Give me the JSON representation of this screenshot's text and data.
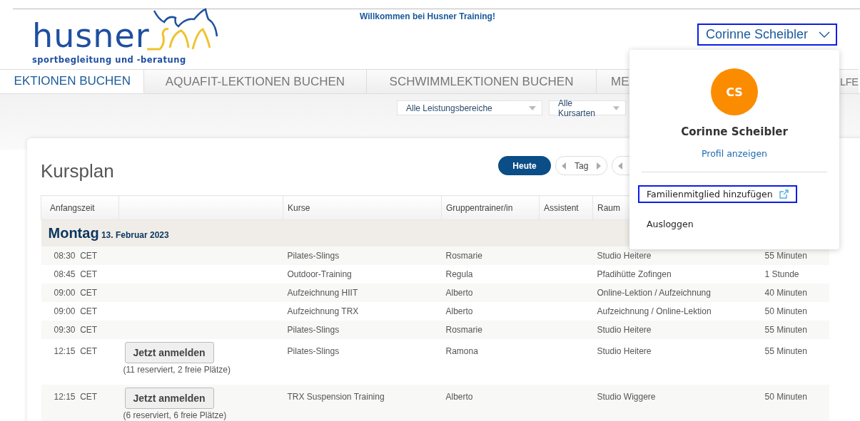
{
  "header": {
    "logo": {
      "wordmark": "husner",
      "tagline": "sportbegleitung und -beratung"
    },
    "welcome": "Willkommen bei Husner Training!",
    "user_button": {
      "label": "Corinne Scheibler",
      "outlined": true,
      "expanded": true
    }
  },
  "tabs": [
    {
      "label": "EKTIONEN BUCHEN",
      "selected": true
    },
    {
      "label": "AQUAFIT-LEKTIONEN BUCHEN",
      "selected": false
    },
    {
      "label": "SCHWIMMLEKTIONEN BUCHEN",
      "selected": false
    },
    {
      "label": "ME",
      "selected": false
    },
    {
      "label": "LFE",
      "selected": false
    }
  ],
  "filters": [
    {
      "label": "Alle Leistungsbereiche"
    },
    {
      "label": "Alle Kursarten"
    }
  ],
  "schedule": {
    "title": "Kursplan",
    "today_button": "Heute",
    "range_button": "Tag",
    "columns": [
      "Anfangszeit",
      "",
      "Kurse",
      "Gruppentrainer/in",
      "Assistent",
      "Raum",
      ""
    ],
    "day": {
      "weekday": "Montag",
      "date": "13. Februar 2023"
    },
    "rows": [
      {
        "kind": "plain",
        "time": "08:30",
        "zone": "CET",
        "course": "Pilates-Slings",
        "trainer": "Rosmarie",
        "room": "Studio Heitere",
        "duration": "55 Minuten"
      },
      {
        "kind": "plain",
        "time": "08:45",
        "zone": "CET",
        "course": "Outdoor-Training",
        "trainer": "Regula",
        "room": "Pfadihütte Zofingen",
        "duration": "1 Stunde"
      },
      {
        "kind": "plain",
        "time": "09:00",
        "zone": "CET",
        "course": "Aufzeichnung HIIT",
        "trainer": "Alberto",
        "room": "Online-Lektion / Aufzeichnung",
        "duration": "40 Minuten"
      },
      {
        "kind": "plain",
        "time": "09:00",
        "zone": "CET",
        "course": "Aufzeichnung TRX",
        "trainer": "Alberto",
        "room": "Aufzeichnung / Online-Lektion",
        "duration": "50 Minuten"
      },
      {
        "kind": "plain",
        "time": "09:30",
        "zone": "CET",
        "course": "Pilates-Slings",
        "trainer": "Rosmarie",
        "room": "Studio Heitere",
        "duration": "55 Minuten"
      },
      {
        "kind": "bookable",
        "time": "12:15",
        "zone": "CET",
        "button": "Jetzt anmelden",
        "note": "(11 reserviert, 2 freie Plätze)",
        "course": "Pilates-Slings",
        "trainer": "Ramona",
        "room": "Studio Heitere",
        "duration": "55 Minuten"
      },
      {
        "kind": "bookable",
        "time": "12:15",
        "zone": "CET",
        "button": "Jetzt anmelden",
        "note": "(6 reserviert, 6 freie Plätze)",
        "course": "TRX Suspension Training",
        "trainer": "Alberto",
        "room": "Studio Wiggere",
        "duration": "50 Minuten"
      }
    ]
  },
  "user_menu": {
    "initials": "CS",
    "name": "Corinne Scheibler",
    "profile_link": "Profil anzeigen",
    "items": [
      {
        "label": "Familienmitglied hinzufügen",
        "external": true,
        "outlined": true
      },
      {
        "label": "Ausloggen",
        "external": false,
        "outlined": false
      }
    ]
  }
}
